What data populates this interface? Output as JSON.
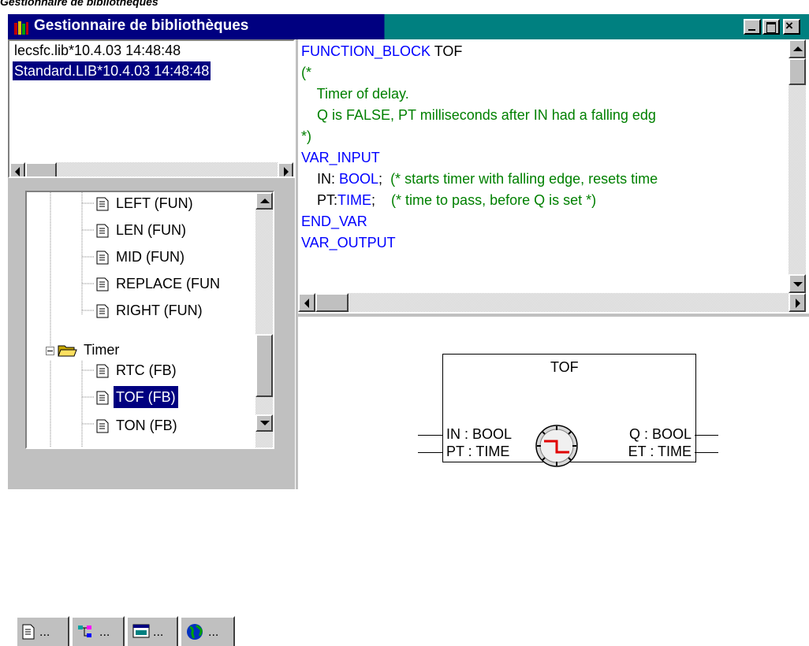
{
  "window": {
    "caption": "Gestionnaire de bibliothèques",
    "title": "Gestionnaire de bibliothèques"
  },
  "libraries": [
    {
      "label": "lecsfc.lib*10.4.03 14:48:48",
      "selected": false
    },
    {
      "label": "Standard.LIB*10.4.03 14:48:48",
      "selected": true
    }
  ],
  "tree": {
    "items": [
      {
        "label": "LEFT (FUN)",
        "type": "doc"
      },
      {
        "label": "LEN (FUN)",
        "type": "doc"
      },
      {
        "label": "MID (FUN)",
        "type": "doc"
      },
      {
        "label": "REPLACE (FUN",
        "type": "doc"
      },
      {
        "label": "RIGHT (FUN)",
        "type": "doc"
      },
      {
        "label": "Timer",
        "type": "folder"
      },
      {
        "label": "RTC (FB)",
        "type": "doc"
      },
      {
        "label": "TOF (FB)",
        "type": "doc",
        "selected": true
      },
      {
        "label": "TON (FB)",
        "type": "doc"
      }
    ]
  },
  "tabs": [
    {
      "label": "...",
      "icon": "pou-icon"
    },
    {
      "label": "...",
      "icon": "data-types-icon"
    },
    {
      "label": "...",
      "icon": "visualization-icon"
    },
    {
      "label": "...",
      "icon": "globe-icon"
    }
  ],
  "code": {
    "line1_kw": "FUNCTION_BLOCK",
    "line1_name": " TOF",
    "line2": "(*",
    "line3": "    Timer of delay.",
    "line4": "    Q is FALSE, PT milliseconds after IN had a falling edg",
    "line5": "*)",
    "line6": "VAR_INPUT",
    "line7_a": "    IN: ",
    "line7_b": "BOOL",
    "line7_c": ";  ",
    "line7_d": "(* starts timer with falling edge, resets time",
    "line8_a": "    PT:",
    "line8_b": "TIME",
    "line8_c": ";    ",
    "line8_d": "(* time to pass, before Q is set *)",
    "line9": "END_VAR",
    "line10": "VAR_OUTPUT"
  },
  "fb": {
    "name": "TOF",
    "in1": "IN : BOOL",
    "in2": "PT : TIME",
    "out1": "Q : BOOL",
    "out2": "ET : TIME"
  },
  "colors": {
    "keyword": "#0000ff",
    "comment": "#008000",
    "selection": "#000080",
    "title_left": "#000080",
    "title_right": "#008080"
  }
}
